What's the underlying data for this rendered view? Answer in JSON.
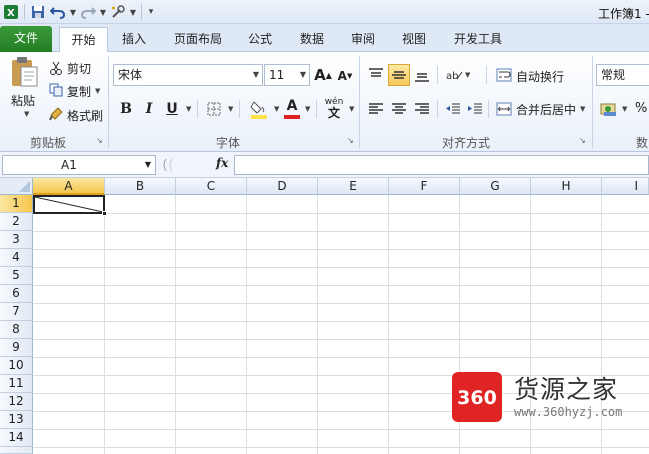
{
  "window": {
    "title": "工作簿1 -"
  },
  "ribbon_tabs": [
    "文件",
    "开始",
    "插入",
    "页面布局",
    "公式",
    "数据",
    "审阅",
    "视图",
    "开发工具"
  ],
  "clipboard": {
    "paste": "粘贴",
    "cut": "剪切",
    "copy": "复制",
    "format_painter": "格式刷",
    "group": "剪贴板"
  },
  "font": {
    "name": "宋体",
    "size": "11",
    "bold": "B",
    "italic": "I",
    "underline": "U",
    "phonetic": "wén",
    "group": "字体",
    "grow": "A",
    "shrink": "A"
  },
  "alignment": {
    "wrap_text": "自动换行",
    "merge_center": "合并后居中",
    "group": "对齐方式"
  },
  "number": {
    "format": "常规",
    "percent": "%",
    "group_partial": "数"
  },
  "formula_bar": {
    "name_box": "A1",
    "fx": "fx",
    "content": ""
  },
  "grid": {
    "columns": [
      "A",
      "B",
      "C",
      "D",
      "E",
      "F",
      "G",
      "H",
      "I"
    ],
    "rows": [
      "1",
      "2",
      "3",
      "4",
      "5",
      "6",
      "7",
      "8",
      "9",
      "10",
      "11",
      "12",
      "13",
      "14"
    ],
    "selected_cell": "A1"
  },
  "watermark": {
    "logo": "360",
    "text": "货源之家",
    "url": "www.360hyzj.com"
  },
  "colors": {
    "file_tab": "#2e8b2e",
    "selection_header": "#f4c64e",
    "font_color": "#e02020",
    "fill_color": "#ffe14a",
    "logo_red": "#e02424"
  }
}
